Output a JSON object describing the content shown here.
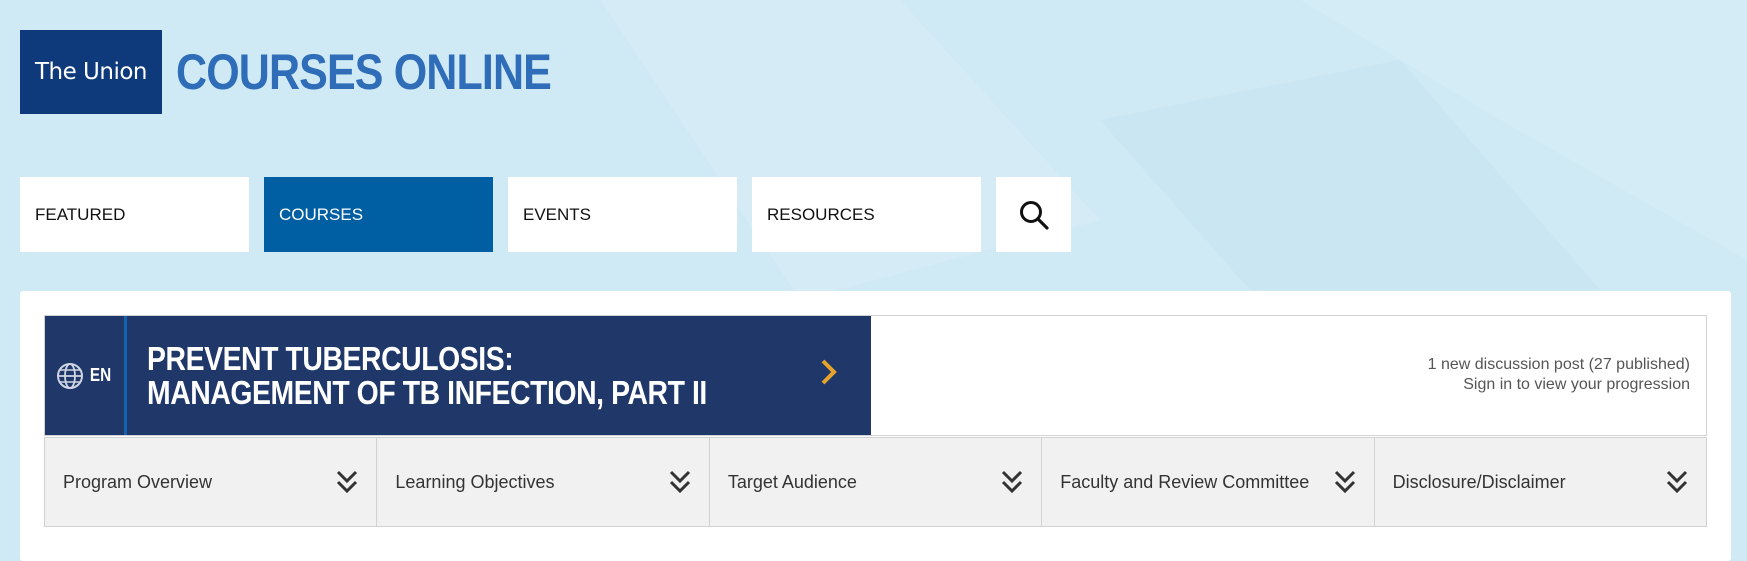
{
  "header": {
    "logo_text": "The Union",
    "title": "COURSES ONLINE"
  },
  "nav": {
    "items": [
      {
        "label": "FEATURED",
        "active": false
      },
      {
        "label": "COURSES",
        "active": true
      },
      {
        "label": "EVENTS",
        "active": false
      },
      {
        "label": "RESOURCES",
        "active": false
      }
    ],
    "search_icon": "search-icon"
  },
  "course": {
    "language": "EN",
    "title_line1": "PREVENT TUBERCULOSIS:",
    "title_line2": "MANAGEMENT OF TB INFECTION, PART II",
    "discussion": "1 new discussion post (27 published)",
    "progression": "Sign in to view your progression"
  },
  "tabs": [
    {
      "label": "Program Overview"
    },
    {
      "label": "Learning Objectives"
    },
    {
      "label": "Target Audience"
    },
    {
      "label": "Faculty and Review Committee"
    },
    {
      "label": "Disclosure/Disclaimer"
    }
  ],
  "colors": {
    "background": "#cfe9f5",
    "logo": "#0e3a7c",
    "title": "#2f6db9",
    "nav_active": "#005fa3",
    "banner": "#1f3769",
    "accent": "#e7a32c"
  }
}
